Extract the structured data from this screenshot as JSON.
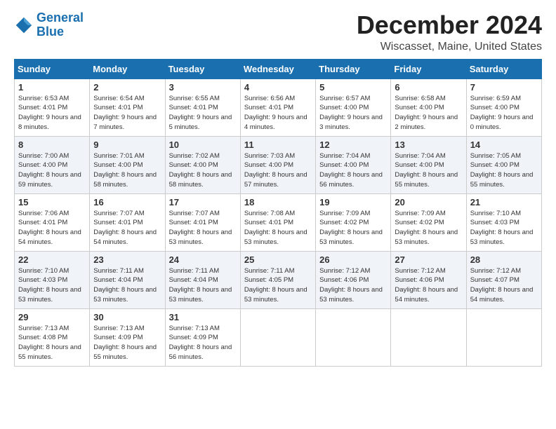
{
  "header": {
    "logo_line1": "General",
    "logo_line2": "Blue",
    "month_title": "December 2024",
    "location": "Wiscasset, Maine, United States"
  },
  "weekdays": [
    "Sunday",
    "Monday",
    "Tuesday",
    "Wednesday",
    "Thursday",
    "Friday",
    "Saturday"
  ],
  "weeks": [
    [
      {
        "day": "1",
        "info": "Sunrise: 6:53 AM\nSunset: 4:01 PM\nDaylight: 9 hours and 8 minutes."
      },
      {
        "day": "2",
        "info": "Sunrise: 6:54 AM\nSunset: 4:01 PM\nDaylight: 9 hours and 7 minutes."
      },
      {
        "day": "3",
        "info": "Sunrise: 6:55 AM\nSunset: 4:01 PM\nDaylight: 9 hours and 5 minutes."
      },
      {
        "day": "4",
        "info": "Sunrise: 6:56 AM\nSunset: 4:01 PM\nDaylight: 9 hours and 4 minutes."
      },
      {
        "day": "5",
        "info": "Sunrise: 6:57 AM\nSunset: 4:00 PM\nDaylight: 9 hours and 3 minutes."
      },
      {
        "day": "6",
        "info": "Sunrise: 6:58 AM\nSunset: 4:00 PM\nDaylight: 9 hours and 2 minutes."
      },
      {
        "day": "7",
        "info": "Sunrise: 6:59 AM\nSunset: 4:00 PM\nDaylight: 9 hours and 0 minutes."
      }
    ],
    [
      {
        "day": "8",
        "info": "Sunrise: 7:00 AM\nSunset: 4:00 PM\nDaylight: 8 hours and 59 minutes."
      },
      {
        "day": "9",
        "info": "Sunrise: 7:01 AM\nSunset: 4:00 PM\nDaylight: 8 hours and 58 minutes."
      },
      {
        "day": "10",
        "info": "Sunrise: 7:02 AM\nSunset: 4:00 PM\nDaylight: 8 hours and 58 minutes."
      },
      {
        "day": "11",
        "info": "Sunrise: 7:03 AM\nSunset: 4:00 PM\nDaylight: 8 hours and 57 minutes."
      },
      {
        "day": "12",
        "info": "Sunrise: 7:04 AM\nSunset: 4:00 PM\nDaylight: 8 hours and 56 minutes."
      },
      {
        "day": "13",
        "info": "Sunrise: 7:04 AM\nSunset: 4:00 PM\nDaylight: 8 hours and 55 minutes."
      },
      {
        "day": "14",
        "info": "Sunrise: 7:05 AM\nSunset: 4:00 PM\nDaylight: 8 hours and 55 minutes."
      }
    ],
    [
      {
        "day": "15",
        "info": "Sunrise: 7:06 AM\nSunset: 4:01 PM\nDaylight: 8 hours and 54 minutes."
      },
      {
        "day": "16",
        "info": "Sunrise: 7:07 AM\nSunset: 4:01 PM\nDaylight: 8 hours and 54 minutes."
      },
      {
        "day": "17",
        "info": "Sunrise: 7:07 AM\nSunset: 4:01 PM\nDaylight: 8 hours and 53 minutes."
      },
      {
        "day": "18",
        "info": "Sunrise: 7:08 AM\nSunset: 4:01 PM\nDaylight: 8 hours and 53 minutes."
      },
      {
        "day": "19",
        "info": "Sunrise: 7:09 AM\nSunset: 4:02 PM\nDaylight: 8 hours and 53 minutes."
      },
      {
        "day": "20",
        "info": "Sunrise: 7:09 AM\nSunset: 4:02 PM\nDaylight: 8 hours and 53 minutes."
      },
      {
        "day": "21",
        "info": "Sunrise: 7:10 AM\nSunset: 4:03 PM\nDaylight: 8 hours and 53 minutes."
      }
    ],
    [
      {
        "day": "22",
        "info": "Sunrise: 7:10 AM\nSunset: 4:03 PM\nDaylight: 8 hours and 53 minutes."
      },
      {
        "day": "23",
        "info": "Sunrise: 7:11 AM\nSunset: 4:04 PM\nDaylight: 8 hours and 53 minutes."
      },
      {
        "day": "24",
        "info": "Sunrise: 7:11 AM\nSunset: 4:04 PM\nDaylight: 8 hours and 53 minutes."
      },
      {
        "day": "25",
        "info": "Sunrise: 7:11 AM\nSunset: 4:05 PM\nDaylight: 8 hours and 53 minutes."
      },
      {
        "day": "26",
        "info": "Sunrise: 7:12 AM\nSunset: 4:06 PM\nDaylight: 8 hours and 53 minutes."
      },
      {
        "day": "27",
        "info": "Sunrise: 7:12 AM\nSunset: 4:06 PM\nDaylight: 8 hours and 54 minutes."
      },
      {
        "day": "28",
        "info": "Sunrise: 7:12 AM\nSunset: 4:07 PM\nDaylight: 8 hours and 54 minutes."
      }
    ],
    [
      {
        "day": "29",
        "info": "Sunrise: 7:13 AM\nSunset: 4:08 PM\nDaylight: 8 hours and 55 minutes."
      },
      {
        "day": "30",
        "info": "Sunrise: 7:13 AM\nSunset: 4:09 PM\nDaylight: 8 hours and 55 minutes."
      },
      {
        "day": "31",
        "info": "Sunrise: 7:13 AM\nSunset: 4:09 PM\nDaylight: 8 hours and 56 minutes."
      },
      null,
      null,
      null,
      null
    ]
  ]
}
